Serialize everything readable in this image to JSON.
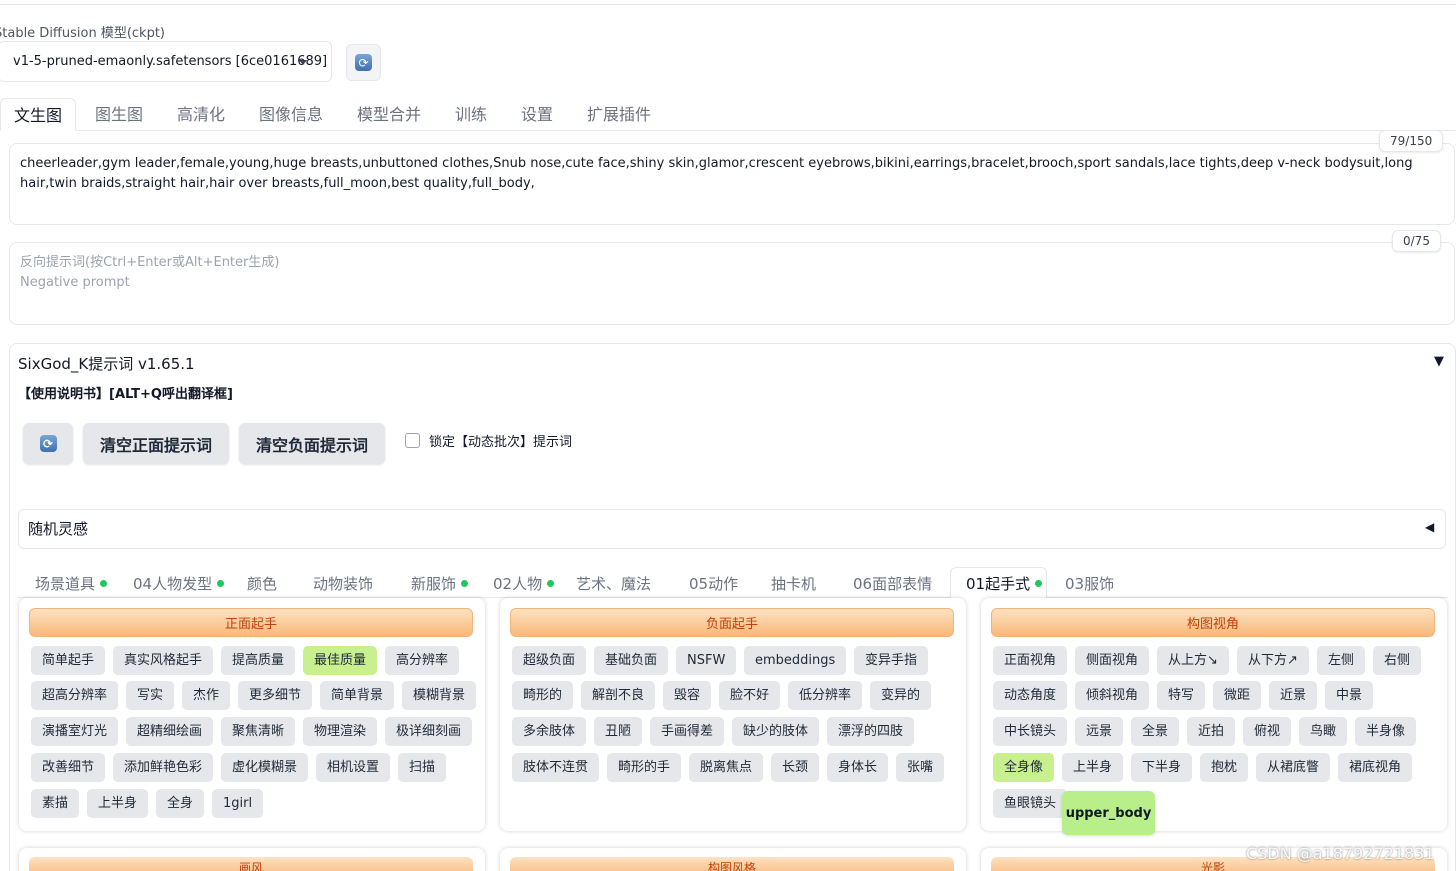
{
  "model": {
    "label": "Stable Diffusion 模型(ckpt)",
    "selected": "v1-5-pruned-emaonly.safetensors [6ce0161689]"
  },
  "main_tabs": [
    "文生图",
    "图生图",
    "高清化",
    "图像信息",
    "模型合并",
    "训练",
    "设置",
    "扩展插件"
  ],
  "prompt": {
    "counter": "79/150",
    "text": "cheerleader,gym leader,female,young,huge breasts,unbuttoned clothes,Snub nose,cute face,shiny skin,glamor,crescent eyebrows,bikini,earrings,bracelet,brooch,sport sandals,lace tights,deep v-neck bodysuit,long hair,twin braids,straight hair,hair over breasts,full_moon,best quality,full_body,"
  },
  "negative": {
    "counter": "0/75",
    "placeholder_line1": "反向提示词(按Ctrl+Enter或Alt+Enter生成)",
    "placeholder_line2": "Negative prompt"
  },
  "extension": {
    "title": "SixGod_K提示词 v1.65.1",
    "toggle": "▼",
    "manual": "【使用说明书】[ALT+Q呼出翻译框]",
    "clear_positive": "清空正面提示词",
    "clear_negative": "清空负面提示词",
    "lock_label": "锁定【动态批次】提示词",
    "random_label": "随机灵感",
    "random_toggle": "◀"
  },
  "sub_tabs": [
    {
      "label": "场景道具",
      "dot": true
    },
    {
      "label": "04人物发型",
      "dot": true
    },
    {
      "label": "颜色",
      "dot": false
    },
    {
      "label": "动物装饰",
      "dot": false
    },
    {
      "label": "新服饰",
      "dot": true
    },
    {
      "label": "02人物",
      "dot": true
    },
    {
      "label": "艺术、魔法",
      "dot": false
    },
    {
      "label": "05动作",
      "dot": false
    },
    {
      "label": "抽卡机",
      "dot": false
    },
    {
      "label": "06面部表情",
      "dot": false
    },
    {
      "label": "01起手式",
      "dot": true
    },
    {
      "label": "03服饰",
      "dot": false
    }
  ],
  "cards": [
    {
      "title": "正面起手",
      "rows": [
        [
          "简单起手",
          "真实风格起手",
          "提高质量",
          "最佳质量",
          "高分辨率"
        ],
        [
          "超高分辨率",
          "写实",
          "杰作",
          "更多细节",
          "简单背景",
          "模糊背景"
        ],
        [
          "演播室灯光",
          "超精细绘画",
          "聚焦清晰",
          "物理渲染",
          "极详细刻画"
        ],
        [
          "改善细节",
          "添加鲜艳色彩",
          "虚化模糊景",
          "相机设置",
          "扫描"
        ],
        [
          "素描",
          "上半身",
          "全身",
          "1girl"
        ]
      ],
      "highlighted": "最佳质量"
    },
    {
      "title": "负面起手",
      "rows": [
        [
          "超级负面",
          "基础负面",
          "NSFW",
          "embeddings",
          "变异手指"
        ],
        [
          "畸形的",
          "解剖不良",
          "毁容",
          "脸不好",
          "低分辨率",
          "变异的"
        ],
        [
          "多余肢体",
          "丑陋",
          "手画得差",
          "缺少的肢体",
          "漂浮的四肢"
        ],
        [
          "肢体不连贯",
          "畸形的手",
          "脱离焦点",
          "长颈",
          "身体长",
          "张嘴"
        ]
      ]
    },
    {
      "title": "构图视角",
      "rows": [
        [
          "正面视角",
          "侧面视角",
          "从上方↘",
          "从下方↗",
          "左侧",
          "右侧"
        ],
        [
          "动态角度",
          "倾斜视角",
          "特写",
          "微距",
          "近景",
          "中景"
        ],
        [
          "中长镜头",
          "远景",
          "全景",
          "近拍",
          "俯视",
          "鸟瞰",
          "半身像"
        ],
        [
          "全身像",
          "上半身",
          "下半身",
          "抱枕",
          "从裙底瞥",
          "裙底视角"
        ],
        [
          "鱼眼镜头"
        ]
      ],
      "highlighted": "全身像"
    }
  ],
  "next_cards": [
    "画风",
    "构图风格",
    "光影"
  ],
  "tooltip": "upper_body",
  "watermark": "CSDN @a18792721831"
}
